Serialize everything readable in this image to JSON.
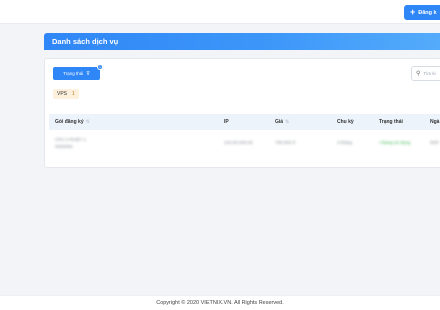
{
  "header": {
    "register_label": "Đăng k"
  },
  "panel": {
    "title": "Danh sách dịch vụ"
  },
  "filters": {
    "status_button": "Trạng thái",
    "status_count": "1",
    "search_placeholder": "Tìm ki",
    "tag": {
      "label": "VPS",
      "count": "1"
    }
  },
  "table": {
    "columns": [
      "Gói đăng ký",
      "IP",
      "Giá",
      "Chu kỳ",
      "Trạng thái",
      "Ngà"
    ],
    "rows": [
      {
        "package_line1": "CPU 2-RUBY 1",
        "package_line2": "0000000",
        "ip": "103.00.000.00",
        "price": "700.000 đ",
        "cycle": "3 tháng",
        "status": "• Đang sử dụng",
        "date": "00/0"
      }
    ]
  },
  "footer": {
    "copyright": "Copyright © 2020 VIETNIX.VN. All Rights Reserved."
  },
  "colors": {
    "primary": "#2f86f6",
    "header_gradient_end": "#56adfb",
    "table_header_bg": "#edf3fb",
    "tag_bg": "#fdf0dc",
    "status_green": "#3fb950",
    "page_bg": "#f2f4f8"
  },
  "icons": {
    "register": "plus-icon",
    "filter": "funnel-icon",
    "search": "search-icon",
    "sort": "sort-icon"
  }
}
